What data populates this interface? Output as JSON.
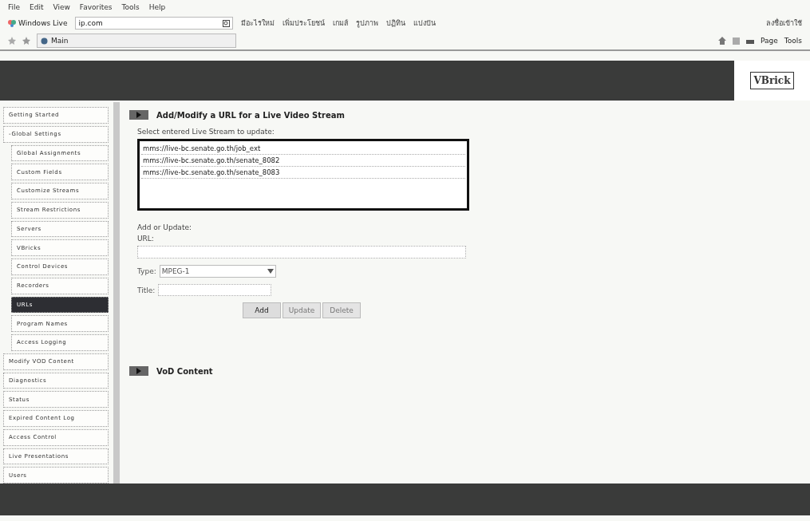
{
  "menu_bar": [
    "File",
    "Edit",
    "View",
    "Favorites",
    "Tools",
    "Help"
  ],
  "live_toolbar": {
    "brand": "Windows Live",
    "search_value": "ip.com",
    "links": [
      "มีอะไรใหม่",
      "เพิ่มประโยชน์",
      "เกมส์",
      "รูปภาพ",
      "ปฏิทิน",
      "แบ่งปัน"
    ],
    "sign_in": "ลงชื่อเข้าใช้"
  },
  "tab": {
    "title": "Main"
  },
  "command_bar": [
    "Page",
    "Tools"
  ],
  "logo": "VBrick",
  "sidebar": {
    "items": [
      {
        "label": "Getting Started",
        "selected": false
      },
      {
        "label": "-Global Settings",
        "selected": false,
        "children": [
          {
            "label": "Global Assignments",
            "selected": false
          },
          {
            "label": "Custom Fields",
            "selected": false
          },
          {
            "label": "Customize Streams",
            "selected": false
          },
          {
            "label": "Stream Restrictions",
            "selected": false
          },
          {
            "label": "Servers",
            "selected": false
          },
          {
            "label": "VBricks",
            "selected": false
          },
          {
            "label": "Control Devices",
            "selected": false
          },
          {
            "label": "Recorders",
            "selected": false
          },
          {
            "label": "URLs",
            "selected": true
          },
          {
            "label": "Program Names",
            "selected": false
          },
          {
            "label": "Access Logging",
            "selected": false
          }
        ]
      },
      {
        "label": "Modify VOD Content",
        "selected": false
      },
      {
        "label": "Diagnostics",
        "selected": false
      },
      {
        "label": "Status",
        "selected": false
      },
      {
        "label": "Expired Content Log",
        "selected": false
      },
      {
        "label": "Access Control",
        "selected": false
      },
      {
        "label": "Live Presentations",
        "selected": false
      },
      {
        "label": "Users",
        "selected": false
      }
    ]
  },
  "live_section": {
    "title": "Add/Modify a URL for a Live Video Stream",
    "list_label": "Select entered Live Stream to update:",
    "streams": [
      "mms://live-bc.senate.go.th/job_ext",
      "mms://live-bc.senate.go.th/senate_8082",
      "mms://live-bc.senate.go.th/senate_8083"
    ],
    "form_label": "Add or Update:",
    "url_label": "URL:",
    "type_label": "Type:",
    "type_value": "MPEG-1",
    "title_label": "Title:",
    "buttons": [
      {
        "label": "Add",
        "disabled": false
      },
      {
        "label": "Update",
        "disabled": true
      },
      {
        "label": "Delete",
        "disabled": true
      }
    ]
  },
  "vod_section": {
    "title": "VoD Content"
  }
}
